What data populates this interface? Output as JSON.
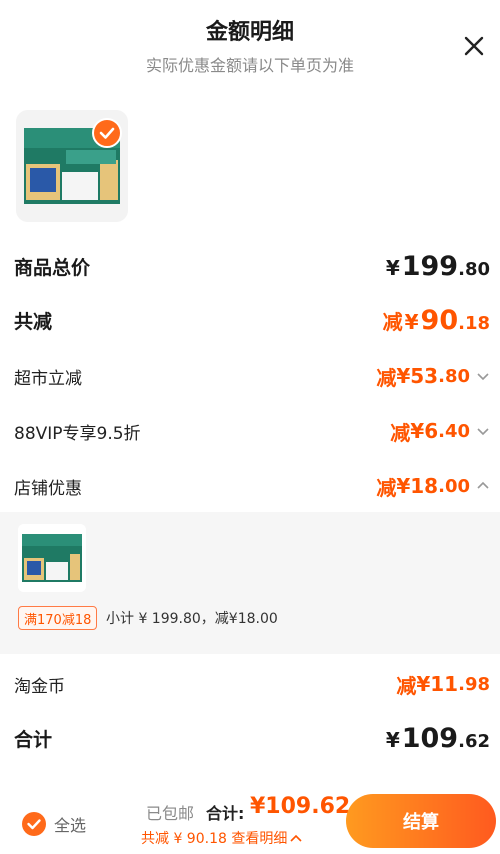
{
  "header": {
    "title": "金额明细",
    "subtitle": "实际优惠金额请以下单页为准"
  },
  "rows": {
    "goods_total": {
      "label": "商品总价",
      "currency": "¥",
      "int": "199",
      "dec": ".80"
    },
    "total_reduce": {
      "label": "共减",
      "prefix": "减",
      "currency": "¥",
      "int": "90",
      "dec": ".18"
    },
    "supermarket": {
      "label": "超市立减",
      "prefix": "减",
      "currency": "¥",
      "int": "53",
      "dec": ".80"
    },
    "vip": {
      "label": "88VIP专享9.5折",
      "prefix": "减",
      "currency": "¥",
      "int": "6",
      "dec": ".40"
    },
    "store": {
      "label": "店铺优惠",
      "prefix": "减",
      "currency": "¥",
      "int": "18",
      "dec": ".00"
    },
    "coins": {
      "label": "淘金币",
      "prefix": "减",
      "currency": "¥",
      "int": "11",
      "dec": ".98"
    },
    "sum": {
      "label": "合计",
      "currency": "¥",
      "int": "109",
      "dec": ".62"
    }
  },
  "store_detail": {
    "promo_tag": "满170减18",
    "subtotal": "小计 ¥ 199.80，减¥18.00"
  },
  "footer": {
    "select_all": "全选",
    "shipped": "已包邮",
    "total_label": "合计:",
    "total_value": "¥109.62",
    "reduce_line": "共减 ¥ 90.18 查看明细",
    "checkout": "结算"
  },
  "colors": {
    "accent": "#ff5500",
    "accent_light": "#ff9a1f"
  },
  "icons": {
    "close": "close-icon",
    "check": "check-icon",
    "chevron_down": "chevron-down-icon",
    "chevron_up": "chevron-up-icon"
  }
}
